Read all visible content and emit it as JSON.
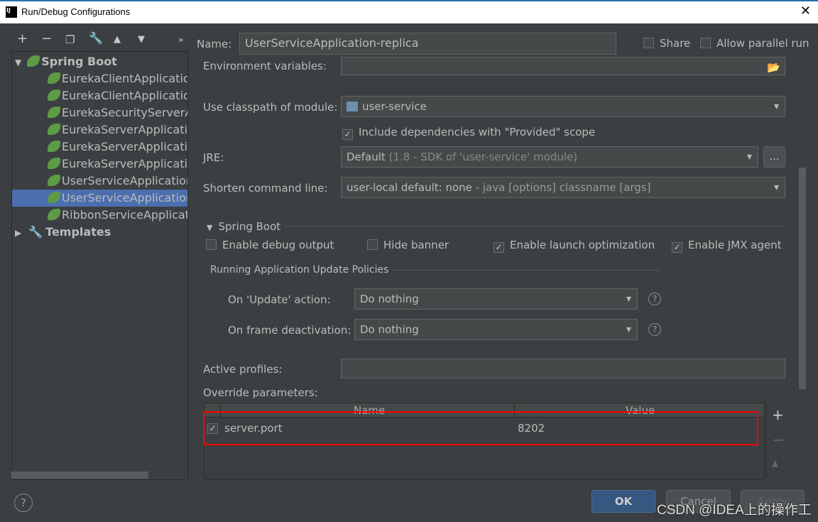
{
  "window": {
    "title": "Run/Debug Configurations",
    "logo": "IJ"
  },
  "toolbar": {
    "icons": [
      "plus-icon",
      "minus-icon",
      "copy-icon",
      "wrench-icon",
      "arrow-up-icon",
      "arrow-down-icon",
      "more-icon"
    ]
  },
  "tree": {
    "group": "Spring Boot",
    "items": [
      "EurekaClientApplication",
      "EurekaClientApplication-",
      "EurekaSecurityServerApp",
      "EurekaServerApplication",
      "EurekaServerApplication",
      "EurekaServerApplication",
      "UserServiceApplication",
      "UserServiceApplication-r",
      "RibbonServiceApplicatic"
    ],
    "selected_index": 7,
    "templates": "Templates"
  },
  "form": {
    "name_label": "Name:",
    "name_value": "UserServiceApplication-replica",
    "share": "Share",
    "allow_parallel": "Allow parallel run",
    "env_label": "Environment variables:",
    "classpath_label": "Use classpath of module:",
    "classpath_value": "user-service",
    "include_deps": "Include dependencies with \"Provided\" scope",
    "jre_label": "JRE:",
    "jre_value": "Default",
    "jre_detail": "(1.8 - SDK of 'user-service' module)",
    "jre_more": "...",
    "shorten_label": "Shorten command line:",
    "shorten_value": "user-local default: none",
    "shorten_detail": "- java [options] classname [args]",
    "spring_section": "Spring Boot",
    "debug_output": "Enable debug output",
    "hide_banner": "Hide banner",
    "launch_opt": "Enable launch optimization",
    "jmx": "Enable JMX agent",
    "policies_title": "Running Application Update Policies",
    "update_label": "On 'Update' action:",
    "update_value": "Do nothing",
    "frame_label": "On frame deactivation:",
    "frame_value": "Do nothing",
    "profiles_label": "Active profiles:",
    "profiles_value": "",
    "override_label": "Override parameters:",
    "table": {
      "headers": [
        "Name",
        "Value"
      ],
      "rows": [
        {
          "checked": true,
          "name": "server.port",
          "value": "8202"
        }
      ]
    }
  },
  "buttons": {
    "ok": "OK",
    "cancel": "Cancel",
    "apply": "Apply",
    "help": "?"
  },
  "watermark": "CSDN @IDEA上的操作工",
  "colors": {
    "selection": "#4b6eaf",
    "highlight_box": "#ff0000",
    "ok": "#365880"
  }
}
